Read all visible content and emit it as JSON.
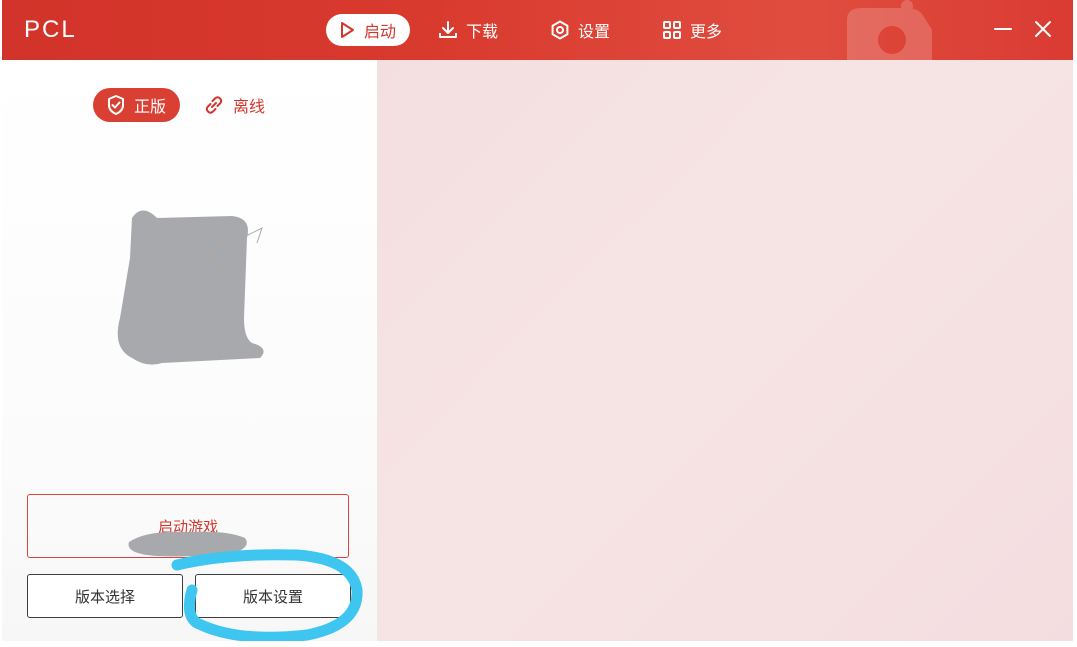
{
  "app": {
    "title": "PCL"
  },
  "nav": {
    "items": [
      {
        "label": "启动",
        "icon": "play-icon",
        "active": true
      },
      {
        "label": "下载",
        "icon": "download-icon",
        "active": false
      },
      {
        "label": "设置",
        "icon": "settings-icon",
        "active": false
      },
      {
        "label": "更多",
        "icon": "grid-icon",
        "active": false
      }
    ]
  },
  "login": {
    "premium_label": "正版",
    "premium_icon": "shield-check-icon",
    "offline_label": "离线",
    "offline_icon": "link-broken-icon"
  },
  "buttons": {
    "launch_label": "启动游戏",
    "version_select_label": "版本选择",
    "version_settings_label": "版本设置"
  },
  "colors": {
    "accent": "#d93f33",
    "title_bar": "#d2332a",
    "highlight_annotation": "#3ec6f0",
    "redaction": "#a8a9ad",
    "right_panel": "#f4dfe0"
  }
}
